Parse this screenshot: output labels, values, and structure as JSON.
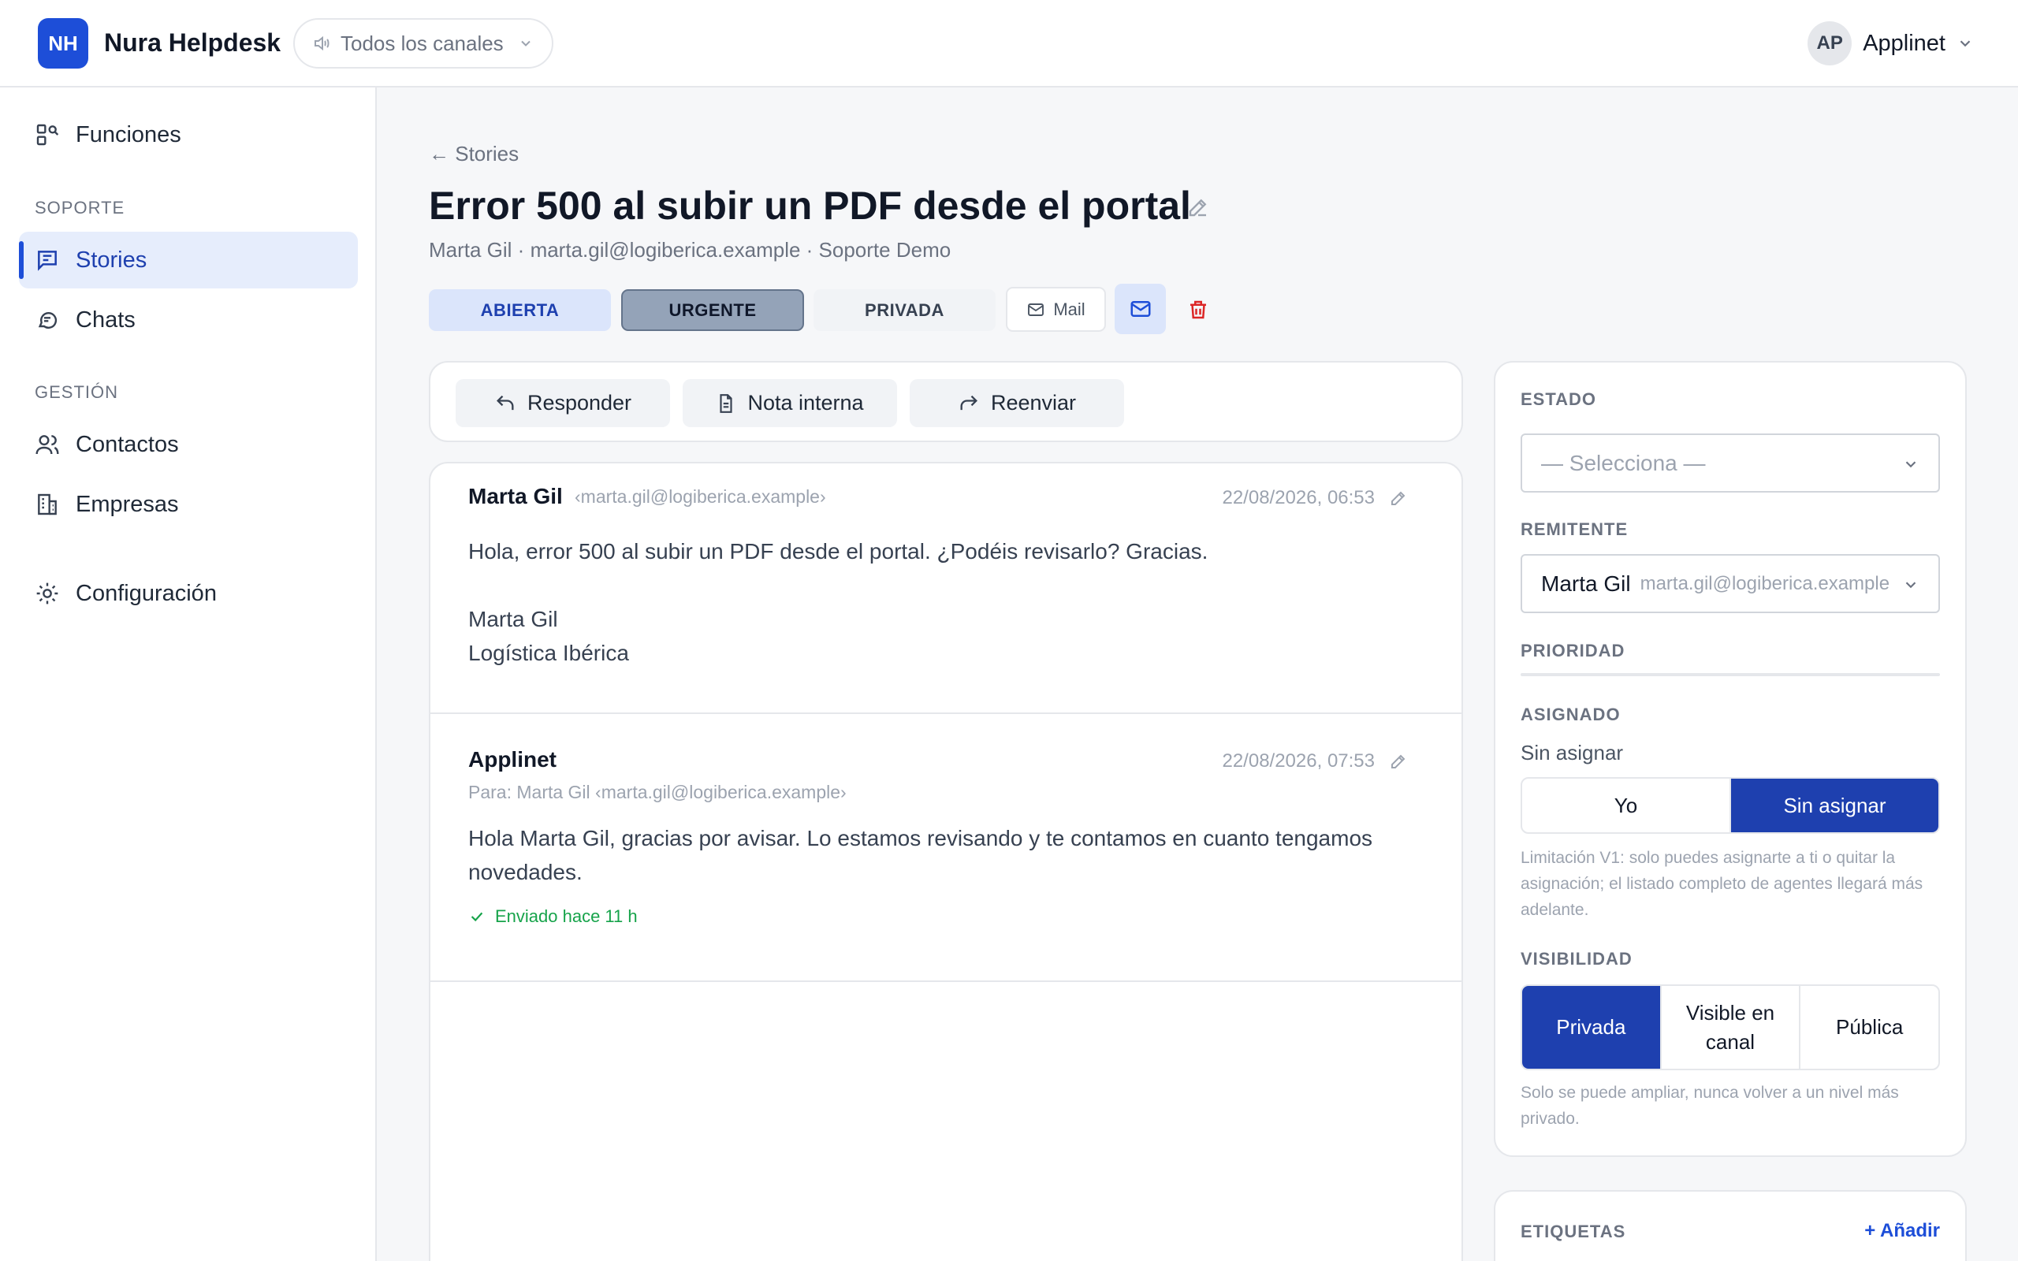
{
  "app": {
    "logo": "NH",
    "name": "Nura Helpdesk"
  },
  "channel_filter": {
    "label": "Todos los canales",
    "icon": "speaker-icon"
  },
  "user": {
    "initials": "AP",
    "name": "Applinet"
  },
  "sidebar": {
    "top_item": {
      "label": "Funciones",
      "icon": "features-icon"
    },
    "sections": [
      {
        "label": "SOPORTE",
        "items": [
          {
            "label": "Stories",
            "icon": "message-square-icon",
            "active": true
          },
          {
            "label": "Chats",
            "icon": "chat-bubbles-icon"
          }
        ]
      },
      {
        "label": "GESTIÓN",
        "items": [
          {
            "label": "Contactos",
            "icon": "users-icon"
          },
          {
            "label": "Empresas",
            "icon": "building-icon"
          }
        ]
      }
    ],
    "settings": {
      "label": "Configuración",
      "icon": "gear-icon"
    }
  },
  "ticket": {
    "back_label": "← Stories",
    "title": "Error 500 al subir un PDF desde el portal",
    "subtitle": "Marta Gil · marta.gil@logiberica.example · Soporte Demo",
    "tags": [
      "ABIERTA",
      "URGENTE",
      "PRIVADA"
    ],
    "mail_label": "Mail"
  },
  "actions": {
    "reply": "Responder",
    "internal_note": "Nota interna",
    "forward": "Reenviar"
  },
  "messages": [
    {
      "from": "Marta Gil",
      "email": "‹marta.gil@logiberica.example›",
      "date": "22/08/2026, 06:53",
      "body": [
        "Hola, error 500 al subir un PDF desde el portal. ¿Podéis revisarlo? Gracias.",
        "",
        "Marta Gil",
        "Logística Ibérica"
      ]
    },
    {
      "from": "Applinet",
      "to": "Para: Marta Gil ‹marta.gil@logiberica.example›",
      "date": "22/08/2026, 07:53",
      "body": [
        "Hola Marta Gil, gracias por avisar. Lo estamos revisando y te contamos en cuanto tengamos",
        "novedades."
      ],
      "status": "Enviado hace 11 h"
    }
  ],
  "details": {
    "estado": {
      "label": "ESTADO",
      "placeholder": "— Selecciona —"
    },
    "remitente": {
      "label": "REMITENTE",
      "name": "Marta Gil",
      "email": "marta.gil@logiberica.example"
    },
    "prioridad": {
      "label": "PRIORIDAD"
    },
    "asignado": {
      "label": "ASIGNADO",
      "value": "Sin asignar",
      "options": [
        "Yo",
        "Sin asignar"
      ],
      "selected": "Sin asignar",
      "help": "Limitación V1: solo puedes asignarte a ti o quitar la asignación; el listado completo de agentes llegará más adelante."
    },
    "visibilidad": {
      "label": "VISIBILIDAD",
      "options": [
        "Privada",
        "Visible en canal",
        "Pública"
      ],
      "selected": "Privada",
      "help": "Solo se puede ampliar, nunca volver a un nivel más privado."
    }
  },
  "etiquetas": {
    "label": "ETIQUETAS",
    "add_label": "+ Añadir"
  },
  "colors": {
    "primary": "#1d4ed8",
    "primary_dark": "#1e40af",
    "success": "#16a34a",
    "danger": "#dc2626"
  }
}
